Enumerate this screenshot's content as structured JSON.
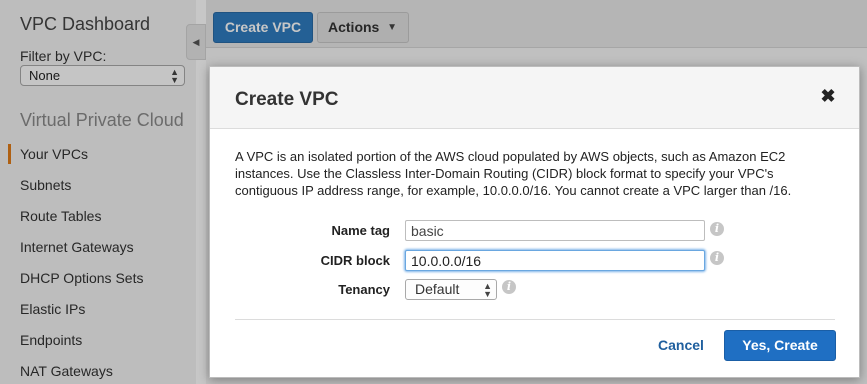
{
  "sidebar": {
    "title": "VPC Dashboard",
    "filter_label": "Filter by VPC:",
    "filter_value": "None",
    "section_title": "Virtual Private Cloud",
    "items": [
      {
        "label": "Your VPCs"
      },
      {
        "label": "Subnets"
      },
      {
        "label": "Route Tables"
      },
      {
        "label": "Internet Gateways"
      },
      {
        "label": "DHCP Options Sets"
      },
      {
        "label": "Elastic IPs"
      },
      {
        "label": "Endpoints"
      },
      {
        "label": "NAT Gateways"
      }
    ],
    "active_item": "Your VPCs"
  },
  "toolbar": {
    "create_label": "Create VPC",
    "actions_label": "Actions"
  },
  "modal": {
    "title": "Create VPC",
    "close_glyph": "✖",
    "description": "A VPC is an isolated portion of the AWS cloud populated by AWS objects, such as Amazon EC2 instances. Use the Classless Inter-Domain Routing (CIDR) block format to specify your VPC's contiguous IP address range, for example, 10.0.0.0/16. You cannot create a VPC larger than /16.",
    "fields": {
      "name_tag": {
        "label": "Name tag",
        "value": "basic"
      },
      "cidr_block": {
        "label": "CIDR block",
        "value": "10.0.0.0/16"
      },
      "tenancy": {
        "label": "Tenancy",
        "value": "Default"
      }
    },
    "cancel_label": "Cancel",
    "submit_label": "Yes, Create"
  },
  "colors": {
    "primary_button": "#1f6fc3",
    "link": "#1f5f9e",
    "active_accent": "#e07b18"
  },
  "icons": {
    "info": "info-icon",
    "close": "close-icon",
    "collapse": "chevron-left-icon"
  }
}
